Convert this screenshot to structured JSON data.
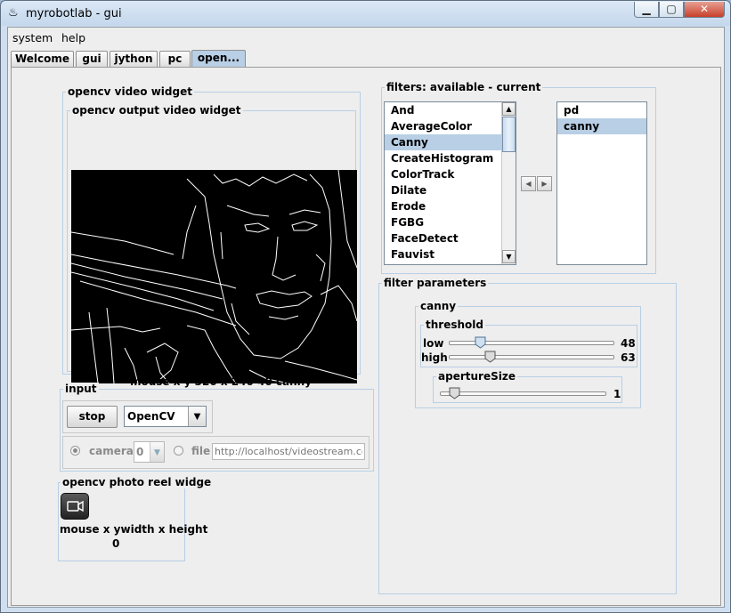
{
  "window": {
    "title": "myrobotlab - gui"
  },
  "menu": {
    "items": [
      "system",
      "help"
    ]
  },
  "tabs": [
    "Welcome",
    "gui",
    "jython",
    "pc",
    "open..."
  ],
  "video_widget": {
    "title": "opencv  video widget",
    "output_title": "opencv output video widget",
    "status": "mouse x y  320 x 240  40  canny"
  },
  "filters": {
    "title": "filters: available - current",
    "available": [
      "And",
      "AverageColor",
      "Canny",
      "CreateHistogram",
      "ColorTrack",
      "Dilate",
      "Erode",
      "FGBG",
      "FaceDetect",
      "Fauvist"
    ],
    "available_selected": "Canny",
    "current": [
      "pd",
      "canny"
    ],
    "current_selected": "canny"
  },
  "filter_params": {
    "title": "filter parameters",
    "filter_name": "canny",
    "threshold_title": "threshold",
    "low_label": "low",
    "low_value": "48",
    "high_label": "high",
    "high_value": "63",
    "aperture_title": "apertureSize",
    "aperture_value": "1"
  },
  "input": {
    "title": "input",
    "stop_label": "stop",
    "source_selected": "OpenCV",
    "camera_label": "camera",
    "camera_index": "0",
    "file_label": "file",
    "file_placeholder": "http://localhost/videostream.cgi"
  },
  "photo_reel": {
    "title": "opencv  photo reel widge",
    "caption": "mouse x ywidth x height",
    "value": "0"
  }
}
